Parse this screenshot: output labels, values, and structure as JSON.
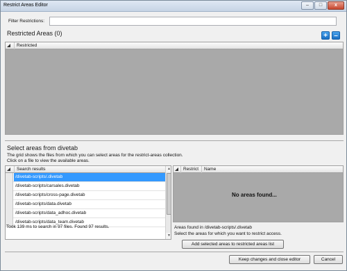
{
  "window": {
    "title": "Restrict Areas Editor",
    "controls": {
      "minimize": "–",
      "maximize": "□",
      "close": "x"
    }
  },
  "filter": {
    "label": "Filter Restrictions:",
    "value": ""
  },
  "restricted": {
    "heading": "Restricted Areas (0)",
    "add_label": "+",
    "remove_label": "–",
    "column": "Restricted"
  },
  "select": {
    "heading": "Select areas from divetab",
    "desc1": "The grid shows the files from which you can select areas for the restrict-areas collection.",
    "desc2": "Click on a file to view the available areas.",
    "results_header": "Search results",
    "results": [
      "/divetab-scripts/.divetab",
      "/divetab-scripts/carsales.divetab",
      "/divetab-scripts/cross-page.divetab",
      "/divetab-scripts/data.divetab",
      "/divetab-scripts/data_adhoc.divetab",
      "/divetab-scripts/data_team.divetab"
    ],
    "status": "Took 139 ms to search in 97 files. Found 97 results.",
    "areas_columns": {
      "restrict": "Restrict",
      "name": "Name"
    },
    "no_areas": "No areas found...",
    "found_in": "Areas found in /divetab-scripts/.divetab",
    "select_hint": "Select the areas for which you want to restrict access.",
    "add_button": "Add selected areas to restricted areas list"
  },
  "footer": {
    "keep_button": "Keep changes and close editor",
    "cancel_button": "Cancel"
  }
}
